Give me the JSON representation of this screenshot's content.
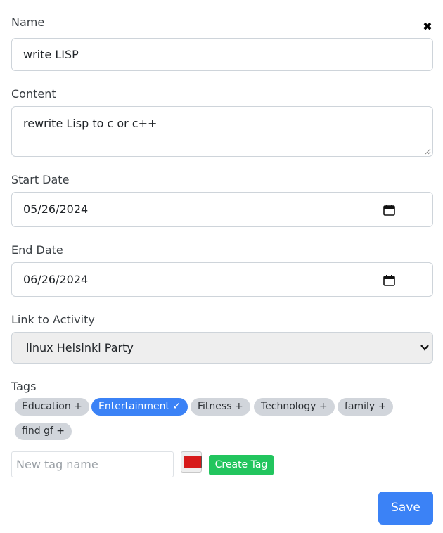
{
  "form": {
    "name_label": "Name",
    "name_value": "write LISP",
    "content_label": "Content",
    "content_value": "rewrite Lisp to c or c++",
    "start_date_label": "Start Date",
    "start_date_value": "05/26/2024",
    "end_date_label": "End Date",
    "end_date_value": "06/26/2024",
    "activity_label": "Link to Activity",
    "activity_value": "linux Helsinki Party",
    "tags_label": "Tags",
    "close_symbol": "✖"
  },
  "tags": [
    {
      "label": "Education +",
      "selected": false
    },
    {
      "label": "Entertainment ✓",
      "selected": true
    },
    {
      "label": "Fitness +",
      "selected": false
    },
    {
      "label": "Technology +",
      "selected": false
    },
    {
      "label": "family +",
      "selected": false
    },
    {
      "label": "find gf +",
      "selected": false
    }
  ],
  "new_tag": {
    "placeholder": "New tag name",
    "color": "#d71a1a",
    "create_label": "Create Tag"
  },
  "save_label": "Save",
  "colors": {
    "primary": "#3b82f6",
    "success": "#22c55e",
    "tag_bg": "#d1d5db"
  },
  "icons": {
    "close": "close-icon",
    "calendar": "calendar-icon",
    "select_arrow": "chevron-down-icon"
  }
}
